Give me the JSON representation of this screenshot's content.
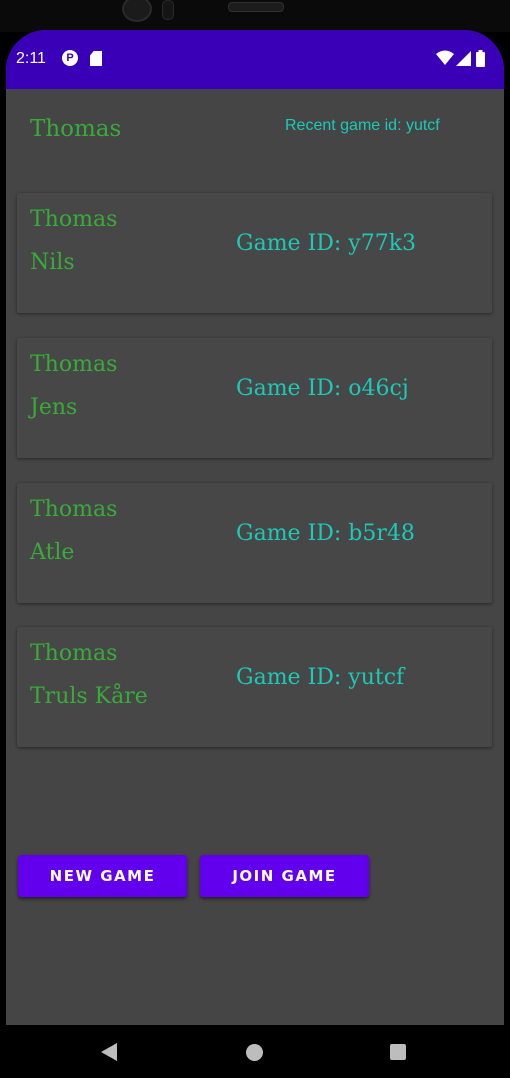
{
  "status_bar": {
    "time": "2:11",
    "color": "#3a00b7",
    "icons": [
      "app-p-icon",
      "sd-card-icon",
      "wifi-icon",
      "cell-signal-icon",
      "battery-icon"
    ]
  },
  "header": {
    "player_name": "Thomas",
    "recent_game": "Recent game id: yutcf"
  },
  "games": [
    {
      "player1": "Thomas",
      "player2": "Nils",
      "game_id": "Game ID: y77k3"
    },
    {
      "player1": "Thomas",
      "player2": "Jens",
      "game_id": "Game ID: o46cj"
    },
    {
      "player1": "Thomas",
      "player2": "Atle",
      "game_id": "Game ID: b5r48"
    },
    {
      "player1": "Thomas",
      "player2": "Truls Kåre",
      "game_id": "Game ID: yutcf"
    }
  ],
  "buttons": {
    "new_game": "NEW GAME",
    "join_game": "JOIN GAME"
  },
  "colors": {
    "accent": "#6200ee",
    "name_green": "#3aab3a",
    "id_teal": "#1dc9b7",
    "background": "#454545"
  },
  "nav": {
    "icons": [
      "back-icon",
      "home-icon",
      "recents-icon"
    ]
  }
}
